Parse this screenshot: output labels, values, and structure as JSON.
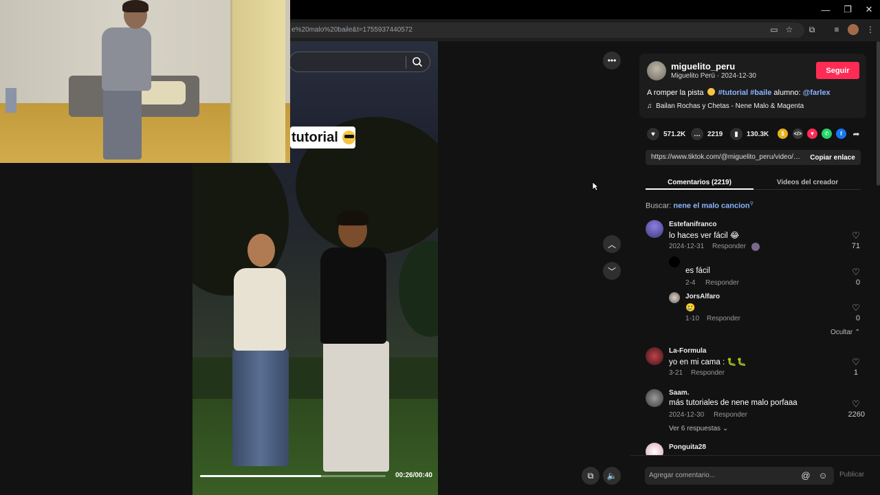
{
  "browser": {
    "url": "e%20malo%20baile&t=1755937440572"
  },
  "video": {
    "caption": "tutorial",
    "time": "00:26/00:40",
    "progress": 0.65
  },
  "creator": {
    "username": "miguelito_peru",
    "display_name": "Miguelito Perú",
    "date": "2024-12-30",
    "follow_label": "Seguir"
  },
  "description": {
    "prefix": "A romper la pista",
    "tag1": "#tutorial",
    "tag2": "#baile",
    "middle": "alumno:",
    "mention": "@farlex"
  },
  "music": "Bailan Rochas y Chetas - Nene Malo & Magenta",
  "stats": {
    "likes": "571.2K",
    "comments": "2219",
    "saves": "130.3K"
  },
  "share_colors": [
    "#e8b21a",
    "#3a3a3a",
    "#fe2c55",
    "#25d366",
    "#1877f2"
  ],
  "link": {
    "url": "https://www.tiktok.com/@miguelito_peru/video/7...",
    "copy_label": "Copiar enlace"
  },
  "tabs": {
    "comments": "Comentarios (2219)",
    "creator_videos": "Videos del creador"
  },
  "search_hint": {
    "label": "Buscar:",
    "query": "nene el malo cancion"
  },
  "comments": [
    {
      "user": "Estefanifranco",
      "text": "lo haces ver fácil 😂",
      "date": "2024-12-31",
      "reply": "Responder",
      "likes": "71"
    },
    {
      "user": "",
      "text": "es fácil",
      "date": "2-4",
      "reply": "Responder",
      "likes": "0"
    },
    {
      "user": "JorsAlfaro",
      "text": "🥲",
      "date": "1-10",
      "reply": "Responder",
      "likes": "0"
    },
    {
      "user": "La-Formula",
      "text": "yo en mi cama : 🐛🐛",
      "date": "3-21",
      "reply": "Responder",
      "likes": "1"
    },
    {
      "user": "Saam.",
      "text": "más tutoriales de nene malo porfaaa",
      "date": "2024-12-30",
      "reply": "Responder",
      "likes": "2260"
    },
    {
      "user": "Ponguita28",
      "text": "",
      "date": "",
      "reply": "",
      "likes": ""
    }
  ],
  "hide_label": "Ocultar",
  "view_replies": "Ver 6 respuestas",
  "composer": {
    "placeholder": "Agregar comentario...",
    "publish": "Publicar"
  }
}
